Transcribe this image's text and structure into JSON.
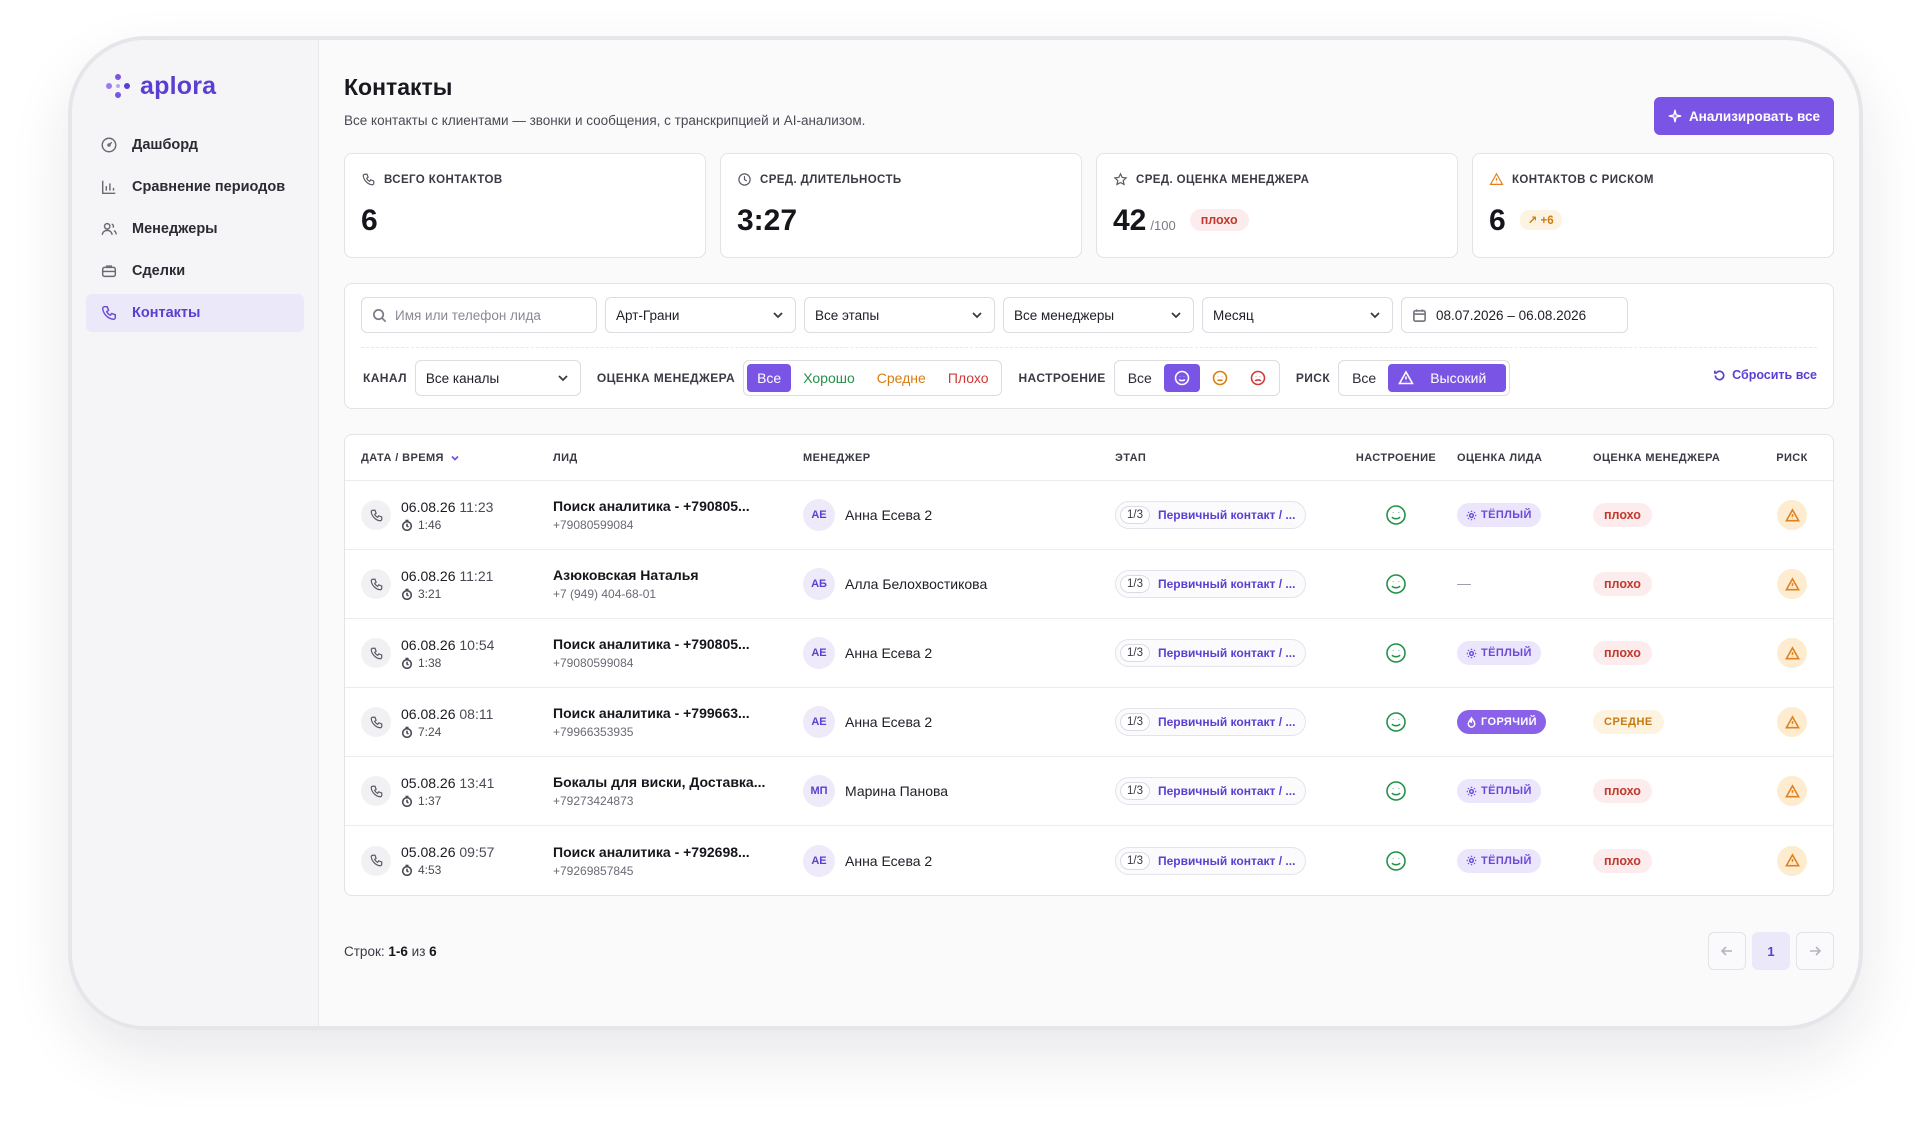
{
  "app": {
    "brand": "aplora"
  },
  "sidebar": {
    "items": [
      {
        "label": "Дашборд",
        "icon": "gauge-icon"
      },
      {
        "label": "Сравнение периодов",
        "icon": "bar-chart-icon"
      },
      {
        "label": "Менеджеры",
        "icon": "users-icon"
      },
      {
        "label": "Сделки",
        "icon": "briefcase-icon"
      },
      {
        "label": "Контакты",
        "icon": "phone-icon",
        "active": true
      }
    ]
  },
  "page": {
    "title": "Контакты",
    "subtitle": "Все контакты с клиентами — звонки и сообщения, с транскрипцией и AI-анализом.",
    "analyze_button": "Анализировать все"
  },
  "stats": {
    "total": {
      "label": "ВСЕГО КОНТАКТОВ",
      "value": "6"
    },
    "duration": {
      "label": "СРЕД. ДЛИТЕЛЬНОСТЬ",
      "value": "3:27"
    },
    "manager_score": {
      "label": "СРЕД. ОЦЕНКА МЕНЕДЖЕРА",
      "value": "42",
      "unit": "/100",
      "badge": "плохо"
    },
    "risk": {
      "label": "КОНТАКТОВ С РИСКОМ",
      "value": "6",
      "badge": "+6"
    }
  },
  "filters": {
    "search_placeholder": "Имя или телефон лида",
    "company": "Арт-Грани",
    "stage": "Все этапы",
    "manager": "Все менеджеры",
    "period": "Месяц",
    "date_range": "08.07.2026 – 06.08.2026",
    "channel_label": "КАНАЛ",
    "channel": "Все каналы",
    "score_label": "ОЦЕНКА МЕНЕДЖЕРА",
    "score_options": [
      "Все",
      "Хорошо",
      "Средне",
      "Плохо"
    ],
    "mood_label": "НАСТРОЕНИЕ",
    "mood_all": "Все",
    "risk_label": "РИСК",
    "risk_all": "Все",
    "risk_high": "Высокий",
    "reset": "Сбросить все"
  },
  "table": {
    "headers": {
      "date": "ДАТА / ВРЕМЯ",
      "lead": "ЛИД",
      "manager": "МЕНЕДЖЕР",
      "stage": "ЭТАП",
      "mood": "НАСТРОЕНИЕ",
      "lead_score": "ОЦЕНКА ЛИДА",
      "manager_score": "ОЦЕНКА МЕНЕДЖЕРА",
      "risk": "РИСК"
    },
    "rows": [
      {
        "date": "06.08.26",
        "time": "11:23",
        "duration": "1:46",
        "lead": "Поиск аналитика - +790805...",
        "phone": "+79080599084",
        "initials": "АЕ",
        "manager": "Анна Есева 2",
        "stage_num": "1/3",
        "stage": "Первичный контакт / ...",
        "lead_score": "ТЁПЛЫЙ",
        "lead_score_type": "warm",
        "manager_score": "плохо",
        "manager_score_type": "bad"
      },
      {
        "date": "06.08.26",
        "time": "11:21",
        "duration": "3:21",
        "lead": "Азюковская Наталья",
        "phone": "+7 (949) 404-68-01",
        "initials": "АБ",
        "manager": "Алла Белохвостикова",
        "stage_num": "1/3",
        "stage": "Первичный контакт / ...",
        "lead_score": "—",
        "lead_score_type": "none",
        "manager_score": "плохо",
        "manager_score_type": "bad"
      },
      {
        "date": "06.08.26",
        "time": "10:54",
        "duration": "1:38",
        "lead": "Поиск аналитика - +790805...",
        "phone": "+79080599084",
        "initials": "АЕ",
        "manager": "Анна Есева 2",
        "stage_num": "1/3",
        "stage": "Первичный контакт / ...",
        "lead_score": "ТЁПЛЫЙ",
        "lead_score_type": "warm",
        "manager_score": "плохо",
        "manager_score_type": "bad"
      },
      {
        "date": "06.08.26",
        "time": "08:11",
        "duration": "7:24",
        "lead": "Поиск аналитика - +799663...",
        "phone": "+79966353935",
        "initials": "АЕ",
        "manager": "Анна Есева 2",
        "stage_num": "1/3",
        "stage": "Первичный контакт / ...",
        "lead_score": "ГОРЯЧИЙ",
        "lead_score_type": "hot",
        "manager_score": "СРЕДНЕ",
        "manager_score_type": "mid"
      },
      {
        "date": "05.08.26",
        "time": "13:41",
        "duration": "1:37",
        "lead": "Бокалы для виски, Доставка...",
        "phone": "+79273424873",
        "initials": "МП",
        "manager": "Марина Панова",
        "stage_num": "1/3",
        "stage": "Первичный контакт / ...",
        "lead_score": "ТЁПЛЫЙ",
        "lead_score_type": "warm",
        "manager_score": "плохо",
        "manager_score_type": "bad"
      },
      {
        "date": "05.08.26",
        "time": "09:57",
        "duration": "4:53",
        "lead": "Поиск аналитика - +792698...",
        "phone": "+79269857845",
        "initials": "АЕ",
        "manager": "Анна Есева 2",
        "stage_num": "1/3",
        "stage": "Первичный контакт / ...",
        "lead_score": "ТЁПЛЫЙ",
        "lead_score_type": "warm",
        "manager_score": "плохо",
        "manager_score_type": "bad"
      }
    ]
  },
  "footer": {
    "rows_label": "Строк:",
    "rows_range": "1-6",
    "rows_of": "из",
    "rows_total": "6",
    "current_page": "1"
  },
  "colors": {
    "accent": "#7a54e4",
    "good": "#23924a",
    "medium": "#d97c12",
    "bad": "#d03a3a",
    "risk": "#e0801f"
  }
}
